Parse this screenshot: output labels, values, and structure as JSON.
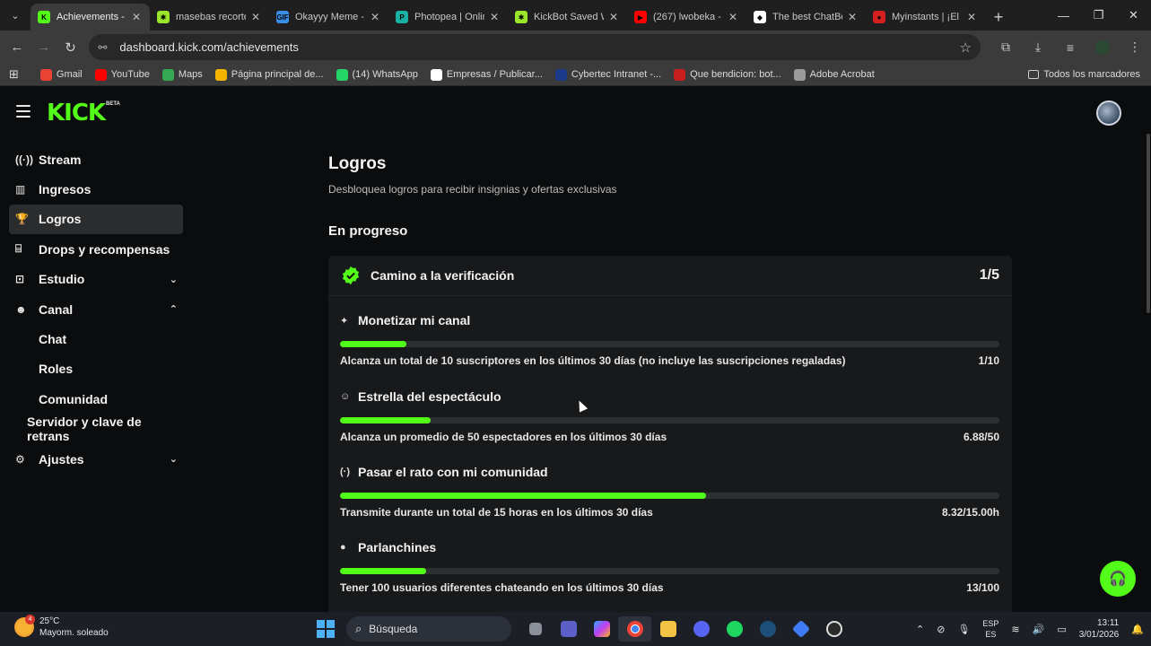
{
  "browser": {
    "tabs": [
      {
        "title": "Achievements - Kick",
        "fav_color": "#53fc18",
        "fav_glyph": "K",
        "active": true
      },
      {
        "title": "masebas recortes",
        "fav_color": "#9ae62b",
        "fav_glyph": "✱",
        "active": false
      },
      {
        "title": "Okayyy Meme - ",
        "fav_color": "#3a8ee6",
        "fav_glyph": "GIF",
        "active": false
      },
      {
        "title": "Photopea | Online",
        "fav_color": "#19b1a3",
        "fav_glyph": "P",
        "active": false
      },
      {
        "title": "KickBot Saved W",
        "fav_color": "#9ae62b",
        "fav_glyph": "✱",
        "active": false
      },
      {
        "title": "(267) lwobeka - ",
        "fav_color": "#ff0000",
        "fav_glyph": "▶",
        "active": false
      },
      {
        "title": "The best ChatBo",
        "fav_color": "#ffffff",
        "fav_glyph": "◆",
        "active": false
      },
      {
        "title": "Myinstants | ¡El s",
        "fav_color": "#d32020",
        "fav_glyph": "●",
        "active": false
      }
    ],
    "url": "dashboard.kick.com/achievements",
    "bookmarks": [
      {
        "label": "Gmail",
        "color": "#ea4335"
      },
      {
        "label": "YouTube",
        "color": "#ff0000"
      },
      {
        "label": "Maps",
        "color": "#34a853"
      },
      {
        "label": "Página principal de...",
        "color": "#f4b400"
      },
      {
        "label": "(14) WhatsApp",
        "color": "#25d366"
      },
      {
        "label": "Empresas / Publicar...",
        "color": "#ffffff"
      },
      {
        "label": "Cybertec Intranet -...",
        "color": "#1b3a8a"
      },
      {
        "label": "Que bendicion: bot...",
        "color": "#c91e1e"
      },
      {
        "label": "Adobe Acrobat",
        "color": "#9a9a9a"
      }
    ],
    "all_bookmarks": "Todos los marcadores"
  },
  "kick": {
    "logo": "KICK",
    "beta": "BETA",
    "accent": "#53fc18",
    "sidebar": [
      {
        "label": "Stream",
        "icon": "broadcast-icon",
        "glyph": "((·))",
        "level": 0
      },
      {
        "label": "Ingresos",
        "icon": "chart-icon",
        "glyph": "▥",
        "level": 0
      },
      {
        "label": "Logros",
        "icon": "trophy-icon",
        "glyph": "🏆",
        "level": 0,
        "active": true
      },
      {
        "label": "Drops y recompensas",
        "icon": "gift-icon",
        "glyph": "⌸",
        "level": 0
      },
      {
        "label": "Estudio",
        "icon": "studio-icon",
        "glyph": "⊡",
        "level": 0,
        "chevron": "down"
      },
      {
        "label": "Canal",
        "icon": "users-icon",
        "glyph": "☻",
        "level": 0,
        "chevron": "up"
      },
      {
        "label": "Chat",
        "level": 1
      },
      {
        "label": "Roles",
        "level": 1
      },
      {
        "label": "Comunidad",
        "level": 1
      },
      {
        "label": "Servidor y clave de retrans",
        "level": 2
      },
      {
        "label": "Ajustes",
        "icon": "gear-icon",
        "glyph": "⚙",
        "level": 0,
        "chevron": "down"
      }
    ],
    "page_title": "Logros",
    "page_subtitle": "Desbloquea logros para recibir insignias y ofertas exclusivas",
    "section_title": "En progreso",
    "card": {
      "title": "Camino a la verificación",
      "count": "1/5",
      "achievements": [
        {
          "title": "Monetizar mi canal",
          "icon": "sparkle-icon",
          "glyph": "✦",
          "description": "Alcanza un total de 10 suscriptores en los últimos 30 días (no incluye las suscripciones regaladas)",
          "progress_text": "1/10",
          "progress": 0.1
        },
        {
          "title": "Estrella del espectáculo",
          "icon": "viewers-icon",
          "glyph": "☺",
          "description": "Alcanza un promedio de 50 espectadores en los últimos 30 días",
          "progress_text": "6.88/50",
          "progress": 0.1376
        },
        {
          "title": "Pasar el rato con mi comunidad",
          "icon": "broadcast-icon",
          "glyph": "(·)",
          "description": "Transmite durante un total de 15 horas en los últimos 30 días",
          "progress_text": "8.32/15.00h",
          "progress": 0.5547
        },
        {
          "title": "Parlanchines",
          "icon": "chat-bubble-icon",
          "glyph": "●",
          "description": "Tener 100 usuarios diferentes chateando en los últimos 30 días",
          "progress_text": "13/100",
          "progress": 0.13
        }
      ]
    }
  },
  "taskbar": {
    "weather_temp": "25°C",
    "weather_desc": "Mayorm. soleado",
    "weather_badge": "4",
    "search_placeholder": "Búsqueda",
    "lang_top": "ESP",
    "lang_bottom": "ES",
    "time": "13:11",
    "date": "3/01/2026"
  }
}
